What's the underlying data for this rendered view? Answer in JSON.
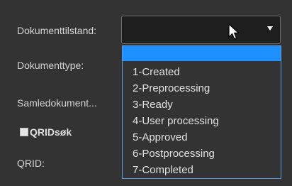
{
  "form": {
    "labels": {
      "document_state": "Dokumenttilstand:",
      "document_type": "Dokumenttype:",
      "collection_document": "Samledokument...",
      "qrid": "QRID:"
    },
    "qrid_search": {
      "label": "QRIDsøk",
      "checked": false
    }
  },
  "state_select": {
    "selected_value": "",
    "icon": "chevron-down-icon",
    "options": [
      "",
      "1-Created",
      "2-Preprocessing",
      "3-Ready",
      "4-User processing",
      "5-Approved",
      "6-Postprocessing",
      "7-Completed"
    ],
    "highlighted_index": 0,
    "highlight_color": "#1e90ff",
    "border_color": "#5b9be0"
  },
  "theme": {
    "background": "#333333",
    "input_background": "#1e1e1e"
  }
}
